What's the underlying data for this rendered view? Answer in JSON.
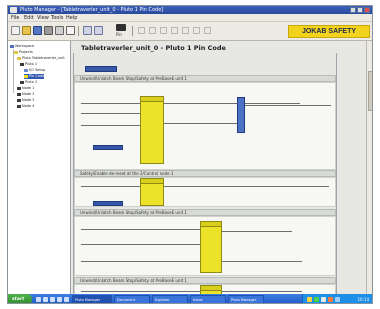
{
  "window": {
    "title": "Pluto Manager - [Tabletraverler_unit_0 - Pluto 1 Pin Code]"
  },
  "menu": [
    "File",
    "Edit",
    "View",
    "Tools",
    "Help"
  ],
  "toolbar": {
    "pin_label": "Pin"
  },
  "logo": {
    "text": "JOKAB SAFETY"
  },
  "tree": {
    "items": [
      {
        "label": "Workspace"
      },
      {
        "label": "Projects"
      },
      {
        "label": "Pluto Tabletraverler_unit"
      },
      {
        "label": "Pluto 1"
      },
      {
        "label": "I/O Setup"
      },
      {
        "label": "Pin Code"
      },
      {
        "label": "Pluto 2"
      },
      {
        "label": "Node 1"
      },
      {
        "label": "Node 2"
      },
      {
        "label": "Node 3"
      },
      {
        "label": "Node 4"
      }
    ]
  },
  "diagram": {
    "title": "Tabletraverler_unit_0 - Pluto 1 Pin Code",
    "networks": [
      {
        "header": "Unwind/Unlatch Beam Stop/Safety at PreBaseE unit 1"
      },
      {
        "header": "Safety/Enable de-reset at the 2/Control node 1"
      },
      {
        "header": "Unwind/Unlatch Beam Stop/Safety at PreBaseE unit 1"
      },
      {
        "header": "Unwind/Unlatch Beam Stop/Safety at PreBaseE unit 1"
      }
    ]
  },
  "taskbar": {
    "start_label": "start",
    "tasks": [
      "Pluto Manager",
      "Document",
      "Explorer",
      "Inbox",
      "Pluto Manager"
    ],
    "clock": "10:14"
  },
  "colors": {
    "function_block": "#ece328",
    "accent_blue": "#3a58a8",
    "logo_bg": "#f2d21a"
  }
}
